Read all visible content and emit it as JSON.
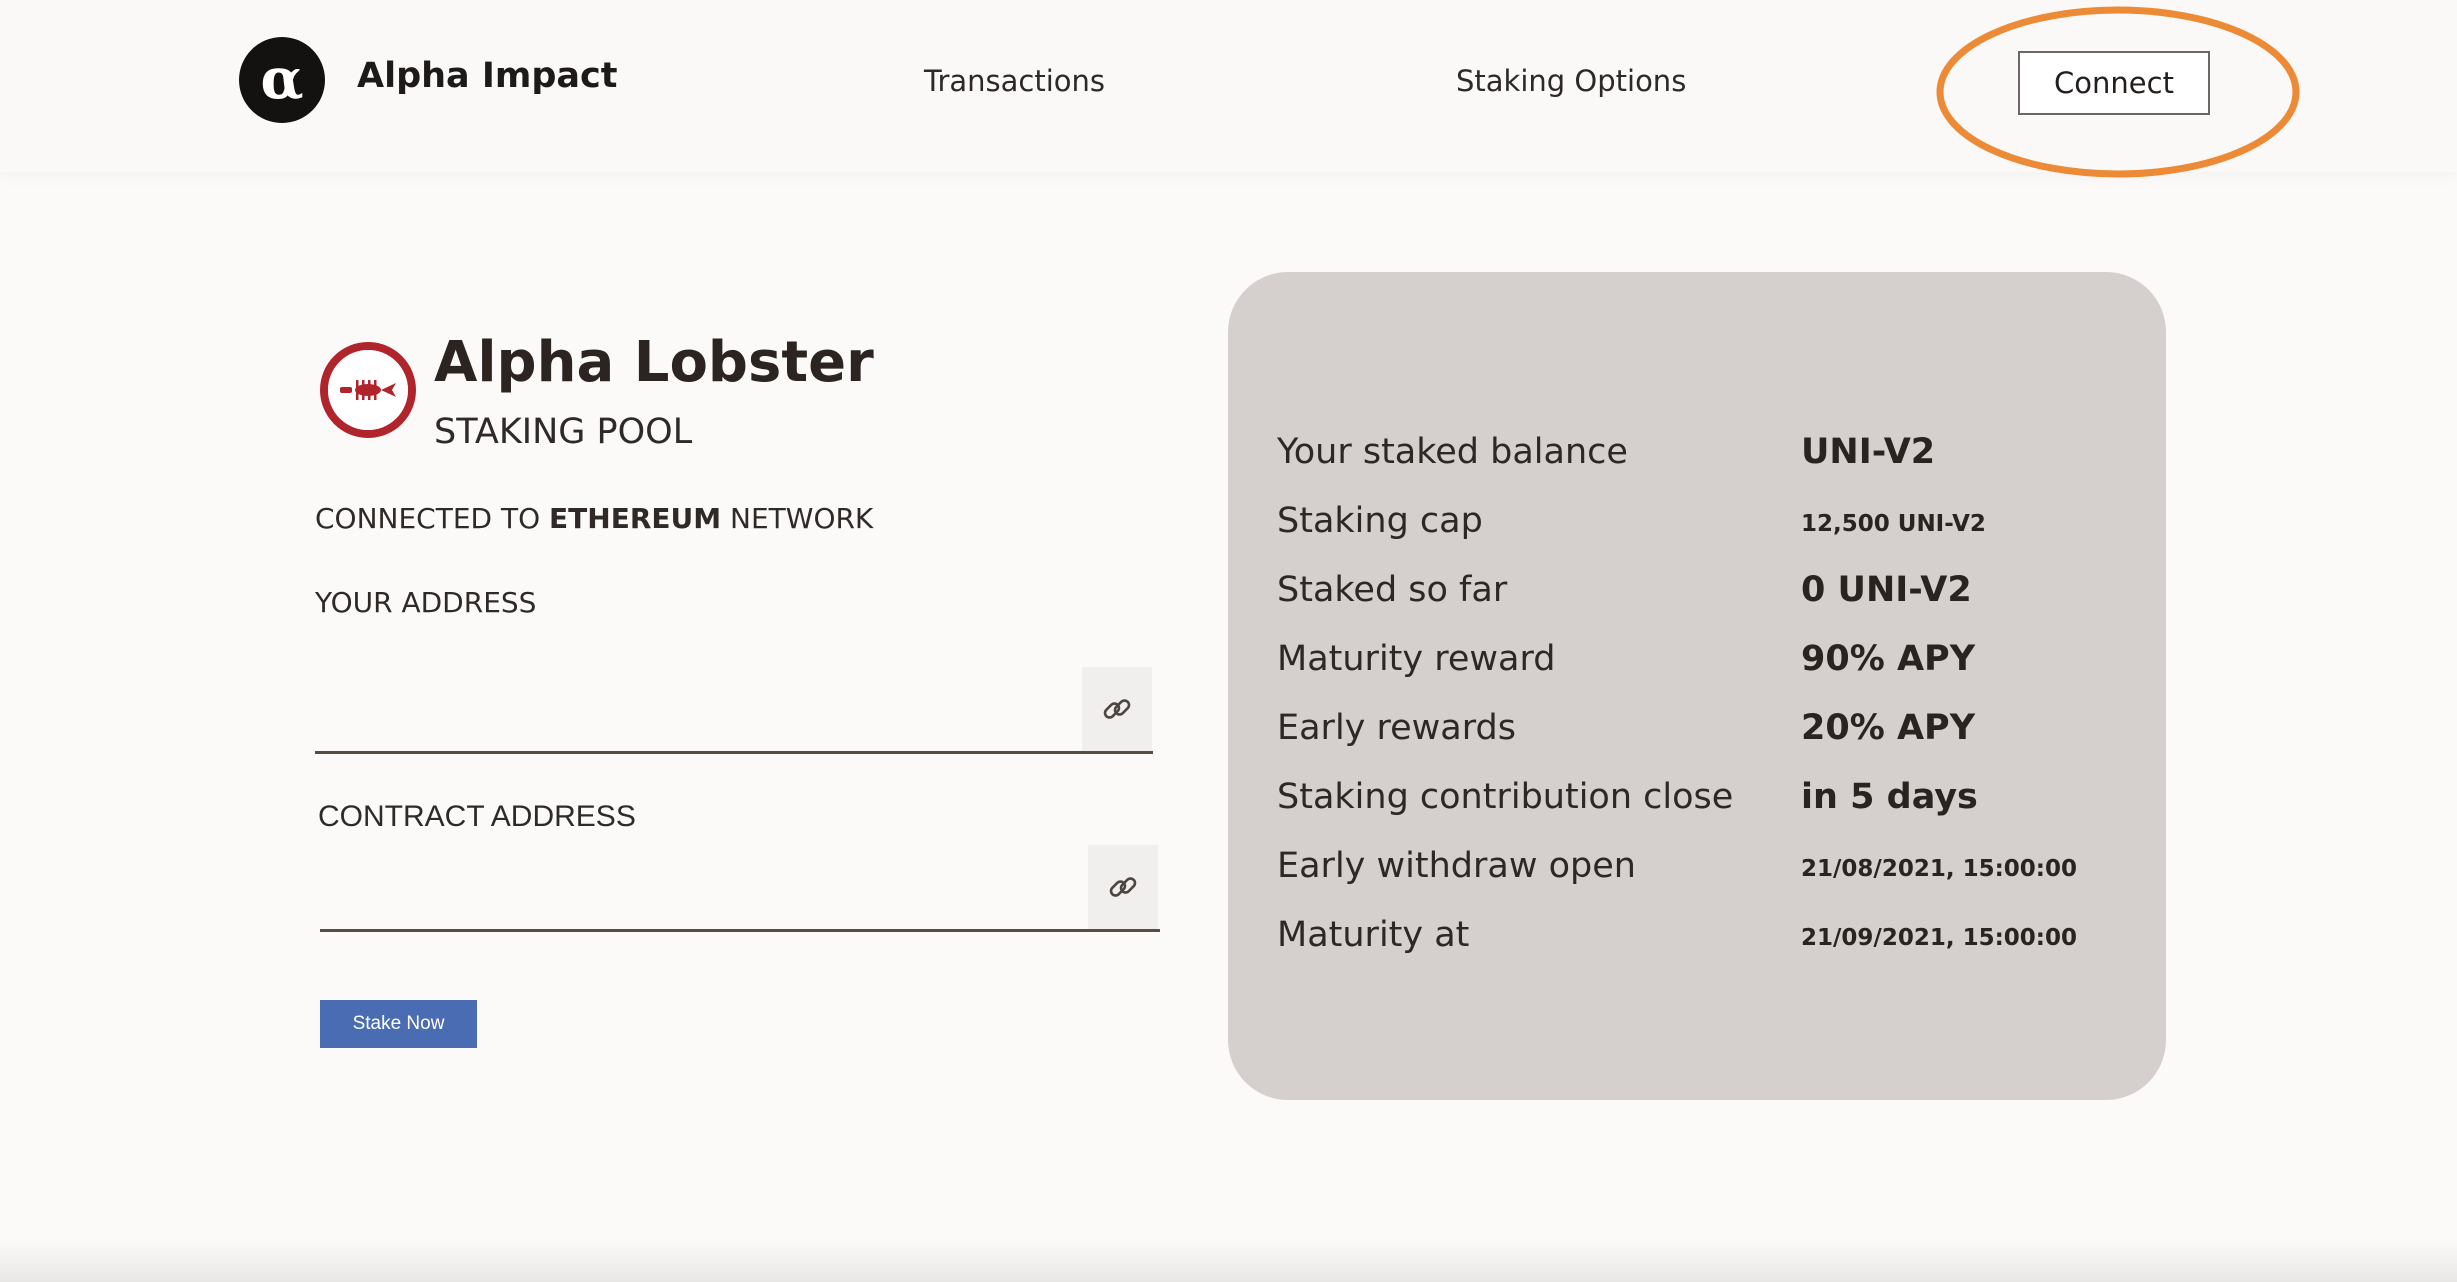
{
  "header": {
    "brand_name": "Alpha Impact",
    "nav": [
      {
        "label": "Transactions"
      },
      {
        "label": "Staking Options"
      }
    ],
    "connect_label": "Connect",
    "highlight_color": "#ec8a35"
  },
  "pool": {
    "title": "Alpha Lobster",
    "subtitle": "STAKING POOL",
    "network_prefix": "CONNECTED TO",
    "network_name": "ETHEREUM",
    "network_suffix": "NETWORK",
    "your_address_label": "YOUR ADDRESS",
    "your_address_value": "",
    "contract_address_label": "CONTRACT ADDRESS",
    "contract_address_value": "",
    "stake_button": "Stake Now",
    "logo_color": "#b0252c"
  },
  "stats": [
    {
      "label": "Your staked balance",
      "value": "UNI-V2",
      "size": "big"
    },
    {
      "label": "Staking cap",
      "value": "12,500 UNI-V2",
      "size": "small"
    },
    {
      "label": "Staked so far",
      "value": "0 UNI-V2",
      "size": "big"
    },
    {
      "label": "Maturity reward",
      "value": "90% APY",
      "size": "big"
    },
    {
      "label": "Early rewards",
      "value": "20% APY",
      "size": "big"
    },
    {
      "label": "Staking contribution close",
      "value": "in 5 days",
      "size": "big"
    },
    {
      "label": "Early withdraw open",
      "value": "21/08/2021, 15:00:00",
      "size": "small"
    },
    {
      "label": "Maturity at",
      "value": "21/09/2021, 15:00:00",
      "size": "small"
    }
  ],
  "colors": {
    "stake_button": "#4a6cb3",
    "card_background": "#d5d0cd"
  }
}
